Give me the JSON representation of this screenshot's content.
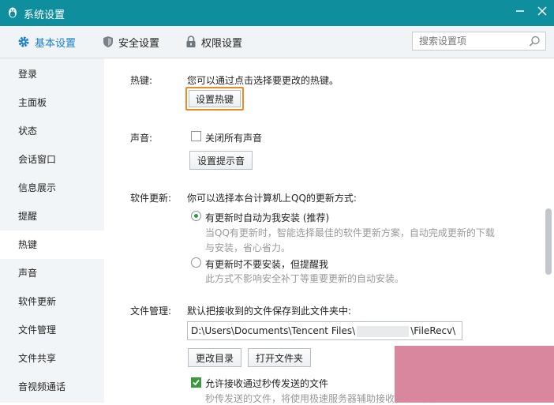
{
  "window": {
    "title": "系统设置"
  },
  "tabs": [
    {
      "label": "基本设置",
      "active": true,
      "icon": "gear-icon"
    },
    {
      "label": "安全设置",
      "active": false,
      "icon": "shield-icon"
    },
    {
      "label": "权限设置",
      "active": false,
      "icon": "lock-icon"
    }
  ],
  "search": {
    "placeholder": "搜索设置项"
  },
  "sidebar": {
    "items": [
      {
        "label": "登录"
      },
      {
        "label": "主面板"
      },
      {
        "label": "状态"
      },
      {
        "label": "会话窗口"
      },
      {
        "label": "信息展示"
      },
      {
        "label": "提醒"
      },
      {
        "label": "热键",
        "active": true
      },
      {
        "label": "声音"
      },
      {
        "label": "软件更新"
      },
      {
        "label": "文件管理"
      },
      {
        "label": "文件共享"
      },
      {
        "label": "音视频通话"
      }
    ]
  },
  "hotkey": {
    "label": "热键:",
    "desc": "您可以通过点击选择要更改的热键。",
    "button": "设置热键"
  },
  "sound": {
    "label": "声音:",
    "mute_all": "关闭所有声音",
    "mute_checked": false,
    "button": "设置提示音"
  },
  "update": {
    "label": "软件更新:",
    "desc": "你可以选择本台计算机上QQ的更新方式:",
    "option1": "有更新时自动为我安装 (推荐)",
    "option1_desc_line1": "当QQ有更新时，智能选择最佳的软件更新方案，自动完成更新的下载",
    "option1_desc_line2": "与安装，省心省力。",
    "option2": "有更新时不要安装，但提醒我",
    "option2_desc": "此方式不影响安全补丁等重要更新的自动安装。",
    "selected": 1
  },
  "files": {
    "label": "文件管理:",
    "desc": "默认把接收到的文件保存到此文件夹中:",
    "path_prefix": "D:\\Users\\Documents\\Tencent Files\\",
    "path_suffix": "\\FileRecv\\",
    "change_button": "更改目录",
    "open_button": "打开文件夹",
    "allow_flash": "允许接收通过秒传发送的文件",
    "allow_flash_checked": true,
    "flash_desc": "秒传发送的文件，将使用极速服务器辅助接收，能提高"
  },
  "colors": {
    "titlebar": "#0f8f9d",
    "accent": "#1d7fcf",
    "highlight": "#f08a1e",
    "check": "#3c9a3e"
  }
}
